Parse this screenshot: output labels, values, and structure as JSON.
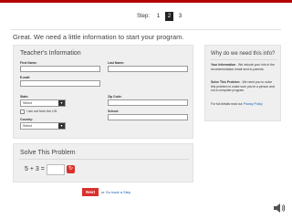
{
  "steps": {
    "label": "Step:",
    "items": [
      "1",
      "2",
      "3"
    ],
    "active_index": 1
  },
  "intro": "Great. We need a little information to start your program.",
  "teacher": {
    "title": "Teacher's Information",
    "first_name_label": "First Name:",
    "last_name_label": "Last Name:",
    "email_label": "E-mail:",
    "state_label": "State:",
    "state_value": "Select",
    "zip_label": "Zip Code:",
    "school_label": "School:",
    "not_from_us_label": "I am not from the US.",
    "country_label": "Country:",
    "country_value": "Select"
  },
  "why": {
    "title": "Why do we need this info?",
    "p1_bold": "Your Information",
    "p1_text": " - We include your info in the recommendation email sent to parents.",
    "p2_bold": "Solve This Problem",
    "p2_text": " - We need you to solve this problem to make sure you're a person and not a computer program.",
    "p3_text": "For full details read our ",
    "p3_link": "Privacy Policy"
  },
  "solve": {
    "title": "Solve This Problem",
    "equation": "5 + 3 ="
  },
  "footer": {
    "next_label": "Next",
    "or_text": "or",
    "back_link": "Go back a Step"
  },
  "colors": {
    "accent": "#d9302c",
    "link": "#1a5fb4",
    "panel": "#efefef"
  },
  "icons": {
    "refresh": "refresh-icon",
    "speaker": "speaker-icon",
    "dropdown": "chevron-down-icon"
  }
}
